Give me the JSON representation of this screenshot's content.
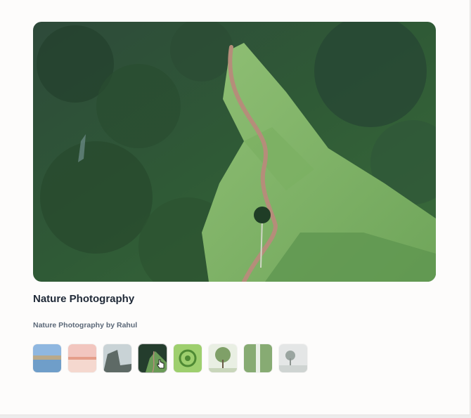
{
  "gallery": {
    "title": "Nature Photography",
    "subtitle": "Nature Photography by Rahul",
    "hero_image": "aerial-green-hill-trail",
    "selected_index": 3,
    "thumbnails": [
      {
        "name": "lake-sky-thumbnail"
      },
      {
        "name": "pink-sunset-thumbnail"
      },
      {
        "name": "rocky-coast-thumbnail"
      },
      {
        "name": "green-hill-trail-thumbnail"
      },
      {
        "name": "green-spiral-plant-thumbnail"
      },
      {
        "name": "lone-tree-thumbnail"
      },
      {
        "name": "waterfall-thumbnail"
      },
      {
        "name": "misty-tree-thumbnail"
      }
    ]
  },
  "colors": {
    "title": "#1f2937",
    "subtitle": "#5b6878",
    "card_background": "#fdfcfb"
  }
}
